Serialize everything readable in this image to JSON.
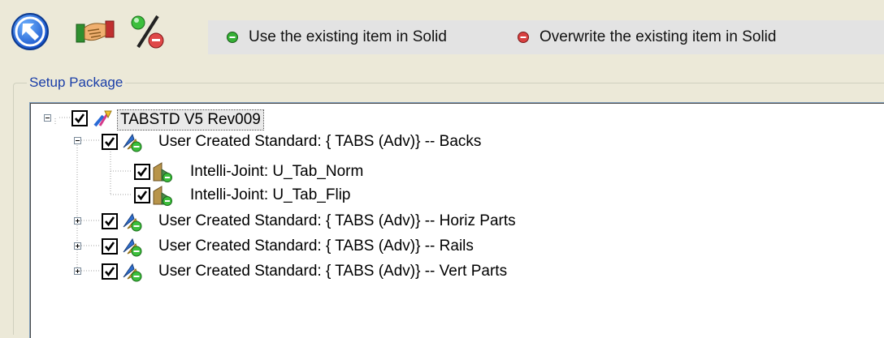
{
  "toolbar": {
    "buttons": [
      {
        "icon": "back-arrow-icon"
      },
      {
        "icon": "handshake-icon"
      },
      {
        "icon": "percent-icon"
      }
    ]
  },
  "legend": {
    "use_existing": {
      "label": "Use the existing item in Solid",
      "color": "#2fae2f"
    },
    "overwrite": {
      "label": "Overwrite the existing item in Solid",
      "color": "#d64040"
    }
  },
  "setup_package": {
    "title": "Setup Package",
    "tree": {
      "root": {
        "label": "TABSTD V5 Rev009",
        "checked": true,
        "expanded": true
      },
      "children": [
        {
          "label": "User Created Standard: { TABS (Adv)} -- Backs",
          "checked": true,
          "expanded": true,
          "children": [
            {
              "label": "Intelli-Joint: U_Tab_Norm",
              "checked": true
            },
            {
              "label": "Intelli-Joint: U_Tab_Flip",
              "checked": true
            }
          ]
        },
        {
          "label": "User Created Standard: { TABS (Adv)} -- Horiz Parts",
          "checked": true,
          "expanded": false
        },
        {
          "label": "User Created Standard: { TABS (Adv)} -- Rails",
          "checked": true,
          "expanded": false
        },
        {
          "label": "User Created Standard: { TABS (Adv)} -- Vert Parts",
          "checked": true,
          "expanded": false
        }
      ]
    }
  }
}
